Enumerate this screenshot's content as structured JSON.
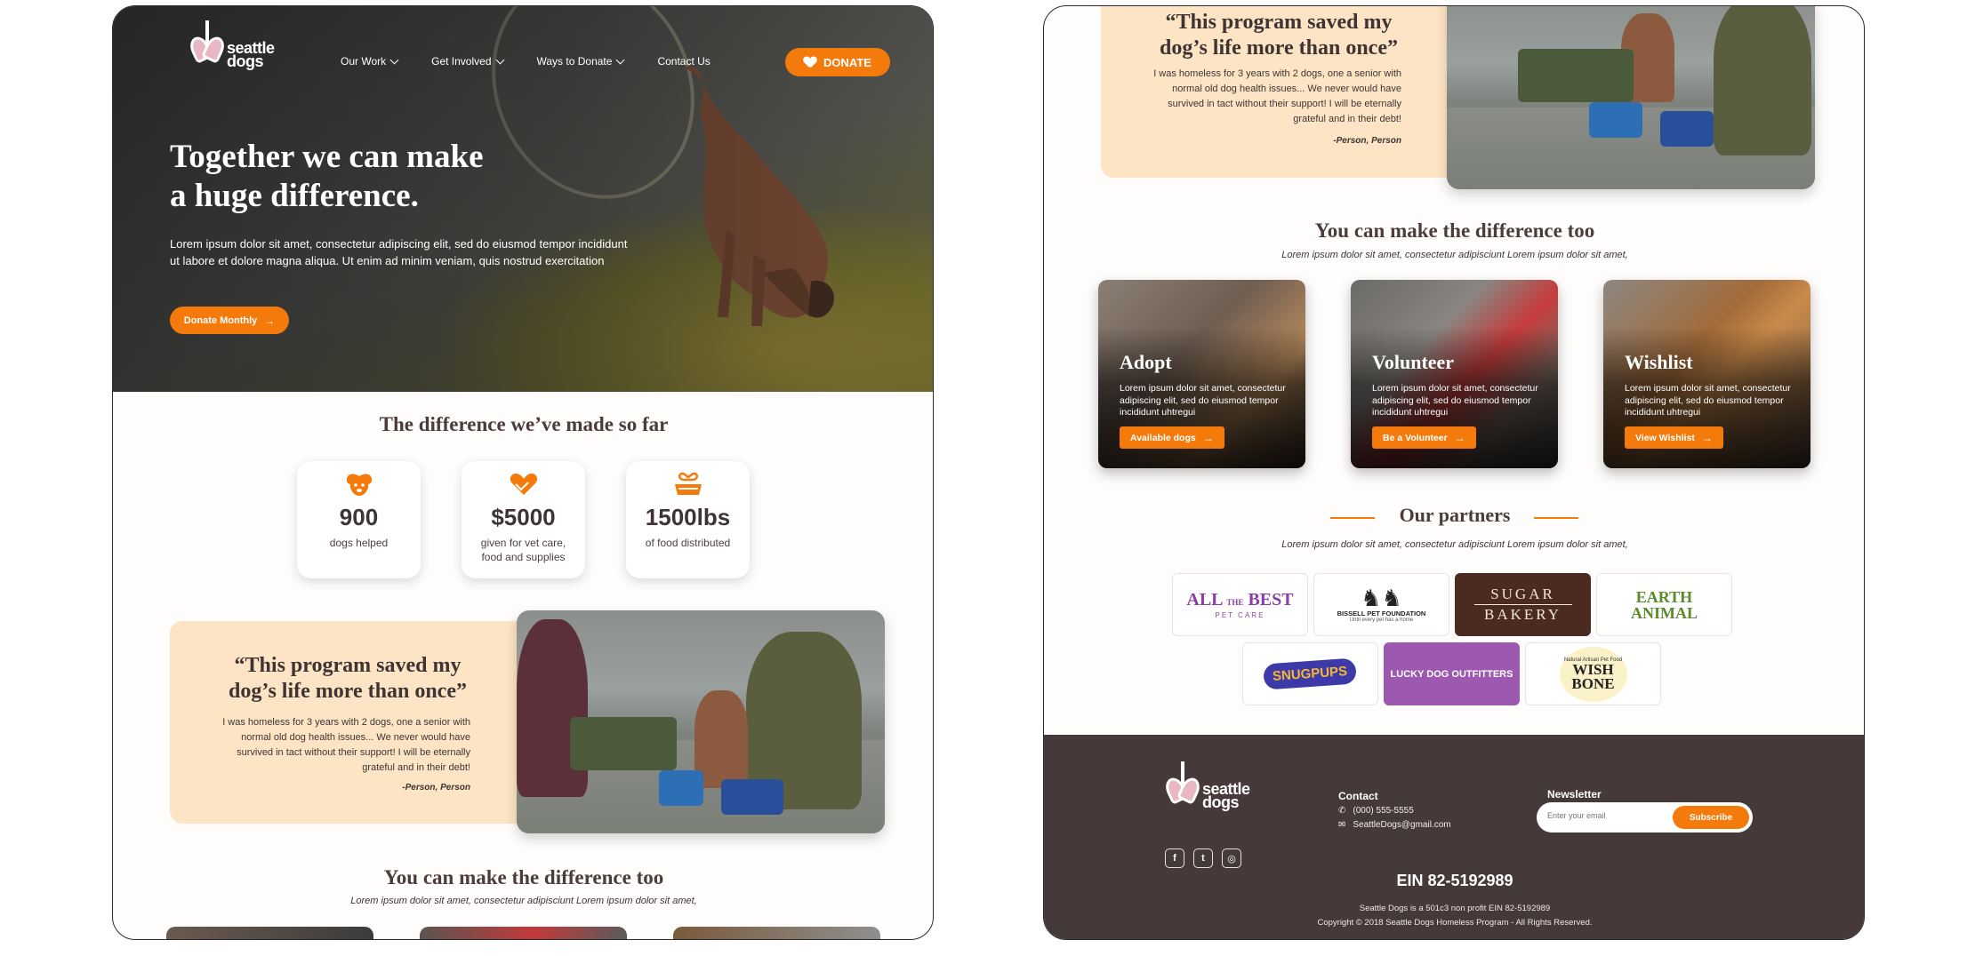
{
  "brand": {
    "line1": "seattle",
    "line2": "dogs"
  },
  "nav": {
    "items": [
      {
        "label": "Our Work",
        "dropdown": true
      },
      {
        "label": "Get Involved",
        "dropdown": true
      },
      {
        "label": "Ways to Donate",
        "dropdown": true
      },
      {
        "label": "Contact Us",
        "dropdown": false
      }
    ],
    "donate_label": "DONATE"
  },
  "hero": {
    "title_line1": "Together we can make",
    "title_line2": "a huge difference.",
    "body": "Lorem ipsum dolor sit amet, consectetur adipiscing elit, sed do eiusmod tempor incididunt ut labore et dolore magna aliqua. Ut enim ad minim veniam, quis nostrud exercitation",
    "cta": "Donate Monthly"
  },
  "impact": {
    "title": "The difference we’ve made so far",
    "stats": [
      {
        "icon": "dog-face-icon",
        "value": "900",
        "label": "dogs helped"
      },
      {
        "icon": "heart-hands-icon",
        "value": "$5000",
        "label": "given for vet care, food and supplies"
      },
      {
        "icon": "food-bowl-icon",
        "value": "1500lbs",
        "label": "of food distributed"
      }
    ]
  },
  "testimonial": {
    "quote_line1": "“This program saved my",
    "quote_line2": "dog’s life more than once”",
    "body": "I was homeless for 3 years with 2 dogs, one a senior with normal old dog health issues... We never would have survived in tact without their support! I will be eternally grateful and in their debt!",
    "author": "-Person, Person"
  },
  "help": {
    "title": "You can make the difference too",
    "subtitle": "Lorem ipsum dolor sit amet, consectetur adipisciunt Lorem ipsum dolor sit amet,",
    "cards": [
      {
        "title": "Adopt",
        "body": "Lorem ipsum dolor sit amet, consectetur adipiscing elit, sed do eiusmod tempor incididunt  uhtregui",
        "button": "Available dogs"
      },
      {
        "title": "Volunteer",
        "body": "Lorem ipsum dolor sit amet, consectetur adipiscing elit, sed do eiusmod tempor incididunt  uhtregui",
        "button": "Be a Volunteer"
      },
      {
        "title": "Wishlist",
        "body": "Lorem ipsum dolor sit amet, consectetur adipiscing elit, sed do eiusmod tempor incididunt  uhtregui",
        "button": "View Wishlist"
      }
    ]
  },
  "partners": {
    "title": "Our partners",
    "subtitle": "Lorem ipsum dolor sit amet, consectetur adipisciunt Lorem ipsum dolor sit amet,",
    "logos": [
      {
        "a": "ALL",
        "b": "THE",
        "c": "BEST",
        "d": "PET CARE"
      },
      {
        "a": "BISSELL PET FOUNDATION",
        "b": "Until every pet has a home"
      },
      {
        "a": "SUGAR",
        "b": "BAKERY"
      },
      {
        "a": "EARTH",
        "b": "ANIMAL"
      },
      {
        "a": "SNUGPUPS"
      },
      {
        "a": "LUCKY DOG OUTFITTERS"
      },
      {
        "a": "Natural Artisan Pet Food",
        "b": "WISH",
        "c": "BONE"
      }
    ]
  },
  "footer": {
    "contact_heading": "Contact",
    "phone": "(000) 555-5555",
    "email": "SeattleDogs@gmail.com",
    "newsletter_heading": "Newsletter",
    "email_placeholder": "Enter your email",
    "subscribe": "Subscribe",
    "social": [
      "facebook-icon",
      "twitter-icon",
      "instagram-icon"
    ],
    "ein": "EIN 82-5192989",
    "legal_line1": "Seattle Dogs is a 501c3 non profit EIN 82-5192989",
    "legal_line2": "Copyright © 2018 Seattle Dogs Homeless Program - All Rights Reserved."
  },
  "colors": {
    "accent": "#f47b0b",
    "quote_bg": "#fde4c4",
    "footer_bg": "#453939",
    "heading": "#4b3d3b"
  }
}
